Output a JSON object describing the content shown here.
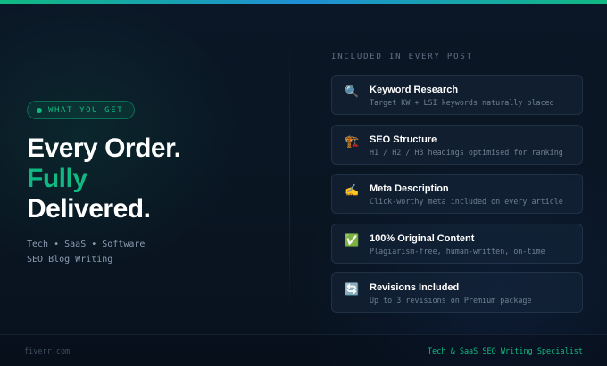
{
  "badge": {
    "label": "WHAT YOU GET"
  },
  "headline": {
    "line1": "Every Order.",
    "line2": "Fully",
    "line3": "Delivered."
  },
  "subtitle": {
    "line1": "Tech • SaaS • Software",
    "line2": "SEO Blog Writing"
  },
  "section": {
    "label": "INCLUDED IN EVERY POST"
  },
  "features": [
    {
      "icon": "🔍",
      "icon_name": "magnifier-icon",
      "title": "Keyword Research",
      "desc": "Target KW + LSI keywords naturally placed"
    },
    {
      "icon": "🏗️",
      "icon_name": "construction-crane-icon",
      "title": "SEO Structure",
      "desc": "H1 / H2 / H3 headings optimised for ranking"
    },
    {
      "icon": "✍️",
      "icon_name": "writing-hand-icon",
      "title": "Meta Description",
      "desc": "Click-worthy meta included on every article"
    },
    {
      "icon": "✅",
      "icon_name": "check-mark-icon",
      "title": "100% Original Content",
      "desc": "Plagiarism-free, human-written, on-time"
    },
    {
      "icon": "🔄",
      "icon_name": "refresh-arrows-icon",
      "title": "Revisions Included",
      "desc": "Up to 3 revisions on Premium package"
    }
  ],
  "footer": {
    "site": "fiverr.com",
    "tagline": "Tech & SaaS SEO Writing Specialist"
  },
  "colors": {
    "accent": "#10b981",
    "background": "#0a1624",
    "text": "#ffffff",
    "muted": "#8b9bb0"
  }
}
